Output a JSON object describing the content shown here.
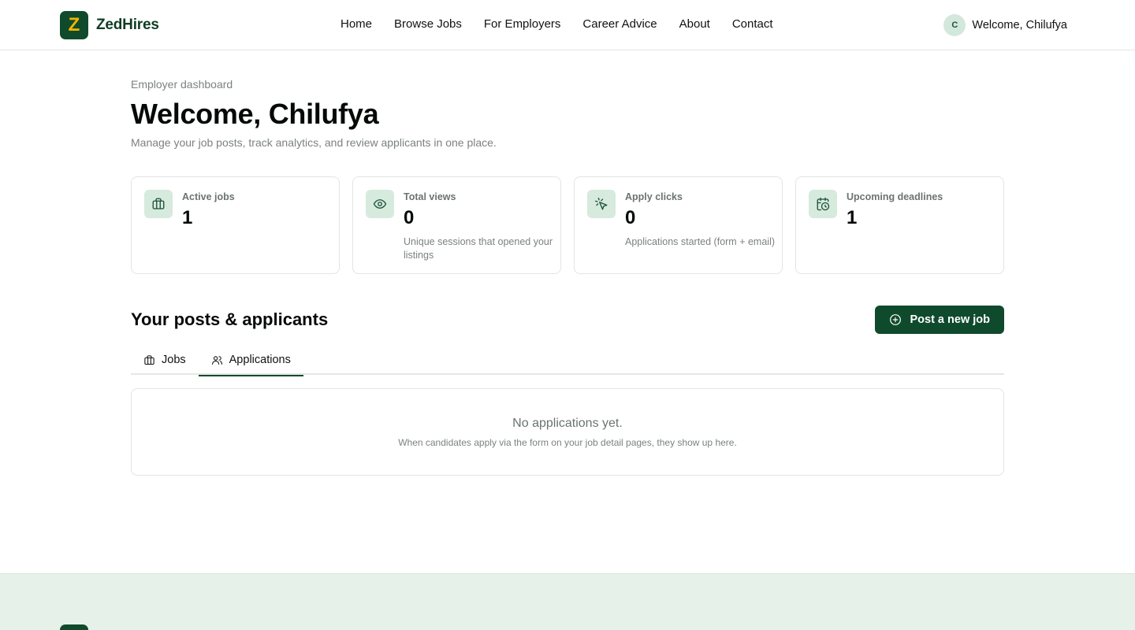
{
  "brand": {
    "name": "ZedHires",
    "logo_letter": "Z"
  },
  "nav": {
    "items": [
      "Home",
      "Browse Jobs",
      "For Employers",
      "Career Advice",
      "About",
      "Contact"
    ]
  },
  "user": {
    "initial": "C",
    "greeting": "Welcome, Chilufya"
  },
  "page": {
    "eyebrow": "Employer dashboard",
    "title": "Welcome, Chilufya",
    "subtitle": "Manage your job posts, track analytics, and review applicants in one place."
  },
  "stats": [
    {
      "icon": "briefcase-icon",
      "label": "Active jobs",
      "value": "1",
      "desc": ""
    },
    {
      "icon": "eye-icon",
      "label": "Total views",
      "value": "0",
      "desc": "Unique sessions that opened your listings"
    },
    {
      "icon": "cursor-click-icon",
      "label": "Apply clicks",
      "value": "0",
      "desc": "Applications started (form + email)"
    },
    {
      "icon": "calendar-clock-icon",
      "label": "Upcoming deadlines",
      "value": "1",
      "desc": ""
    }
  ],
  "section": {
    "title": "Your posts & applicants",
    "post_button": "Post a new job"
  },
  "tabs": [
    {
      "label": "Jobs",
      "icon": "briefcase-icon",
      "active": false
    },
    {
      "label": "Applications",
      "icon": "users-icon",
      "active": true
    }
  ],
  "empty_state": {
    "title": "No applications yet.",
    "desc": "When candidates apply via the form on your job detail pages, they show up here."
  },
  "colors": {
    "brand_green": "#0f4a2c",
    "brand_accent": "#f4b400",
    "icon_bg": "#d6eadd",
    "footer_bg": "#e6f1ea"
  }
}
